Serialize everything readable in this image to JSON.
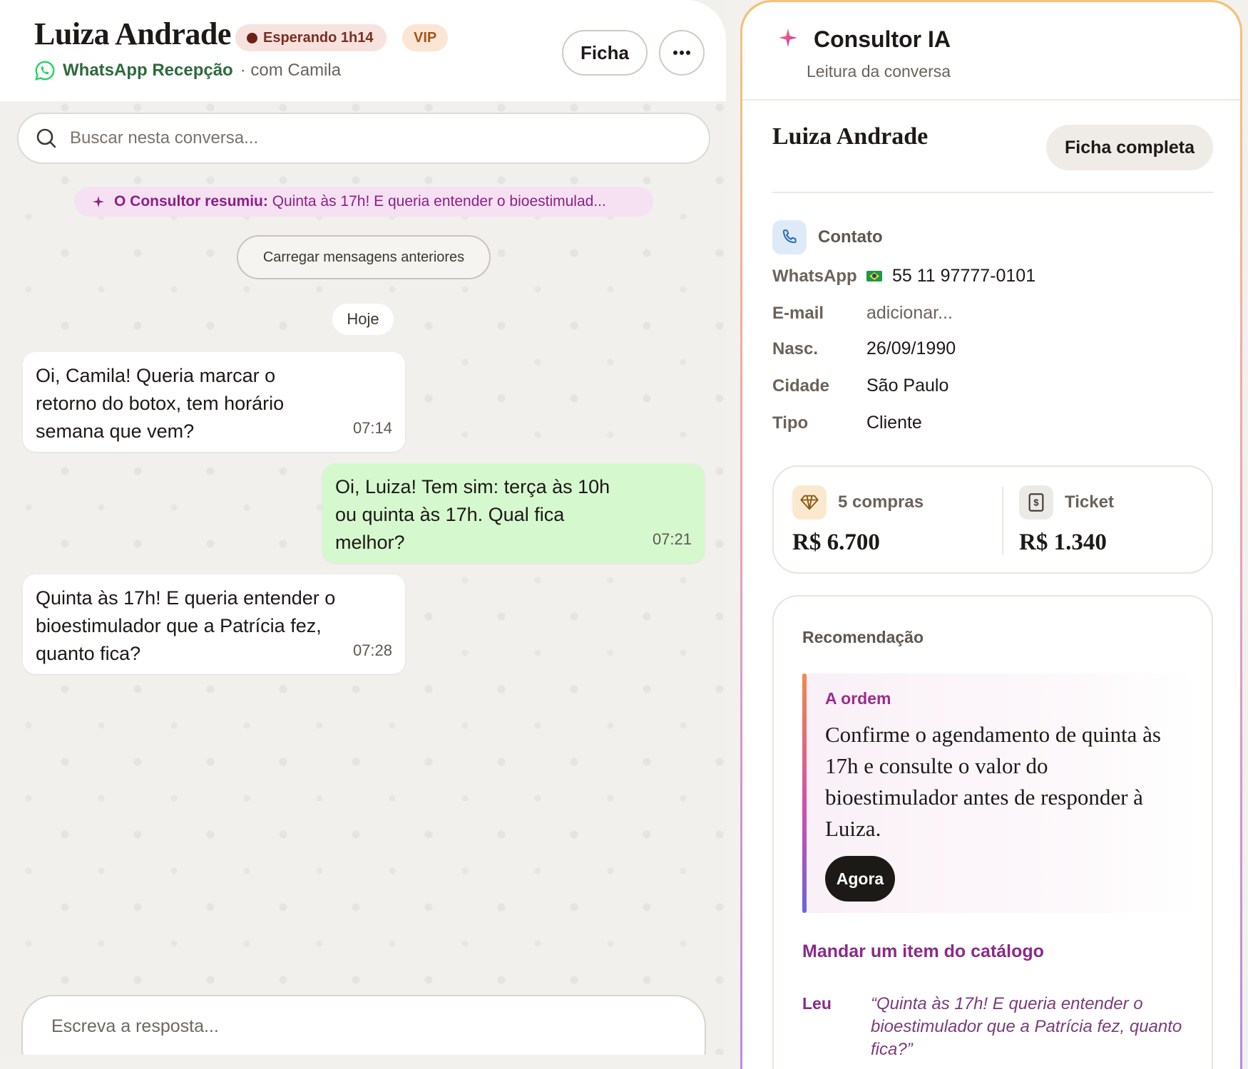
{
  "header": {
    "contact_name": "Luiza Andrade",
    "wait_badge": "Esperando 1h14",
    "vip_badge": "VIP",
    "channel": "WhatsApp Recepção",
    "with_agent": "· com Camila",
    "ficha_label": "Ficha",
    "more_label": "···"
  },
  "search": {
    "placeholder": "Buscar nesta conversa..."
  },
  "summary": {
    "prefix": "O Consultor resumiu:",
    "text": "Quinta às 17h! E queria entender o bioestimulad..."
  },
  "load_more_label": "Carregar mensagens anteriores",
  "day_label": "Hoje",
  "messages": [
    {
      "text": "Oi, Camila! Queria marcar o retorno do botox, tem horário semana que vem?",
      "time": "07:14"
    },
    {
      "text": "Oi, Luiza! Tem sim: terça às 10h ou quinta às 17h. Qual fica melhor?",
      "time": "07:21"
    },
    {
      "text": "Quinta às 17h! E queria entender o bioestimulador que a Patrícia fez, quanto fica?",
      "time": "07:28"
    }
  ],
  "composer": {
    "placeholder": "Escreva a resposta..."
  },
  "panel": {
    "title": "Consultor IA",
    "subtitle": "Leitura da conversa",
    "client_name": "Luiza Andrade",
    "ficha_completa_label": "Ficha completa",
    "contact_label": "Contato",
    "fields": [
      {
        "key": "WhatsApp",
        "value": "55 11 97777-0101"
      },
      {
        "key": "E-mail",
        "value": "adicionar..."
      },
      {
        "key": "Nasc.",
        "value": "26/09/1990"
      },
      {
        "key": "Cidade",
        "value": "São Paulo"
      },
      {
        "key": "Tipo",
        "value": "Cliente"
      }
    ],
    "stats": [
      {
        "label": "5 compras",
        "value": "R$ 6.700"
      },
      {
        "label": "Ticket",
        "value": "R$ 1.340"
      }
    ],
    "recommendation": {
      "label": "Recomendação",
      "kicker": "A ordem",
      "text": "Confirme o agendamento de quinta às 17h e consulte o valor do bioestimulador antes de responder à Luiza.",
      "button": "Agora",
      "catalog_link": "Mandar um item do catálogo",
      "read_label": "Leu",
      "read_quote": "“Quinta às 17h! E queria entender o bioestimulador que a Patrícia fez, quanto fica?”"
    }
  },
  "colors": {
    "accent_purple": "#8a2a8a",
    "out_bubble": "#d6f8cf",
    "whatsapp_green": "#25d366",
    "wait_badge_bg": "#f8e2dd",
    "vip_badge_bg": "#fbe5d4"
  },
  "icons": [
    "whatsapp-icon",
    "more-icon",
    "search-icon",
    "sparkle-icon",
    "phone-icon",
    "diamond-icon",
    "receipt-icon",
    "brazil-flag-icon"
  ]
}
